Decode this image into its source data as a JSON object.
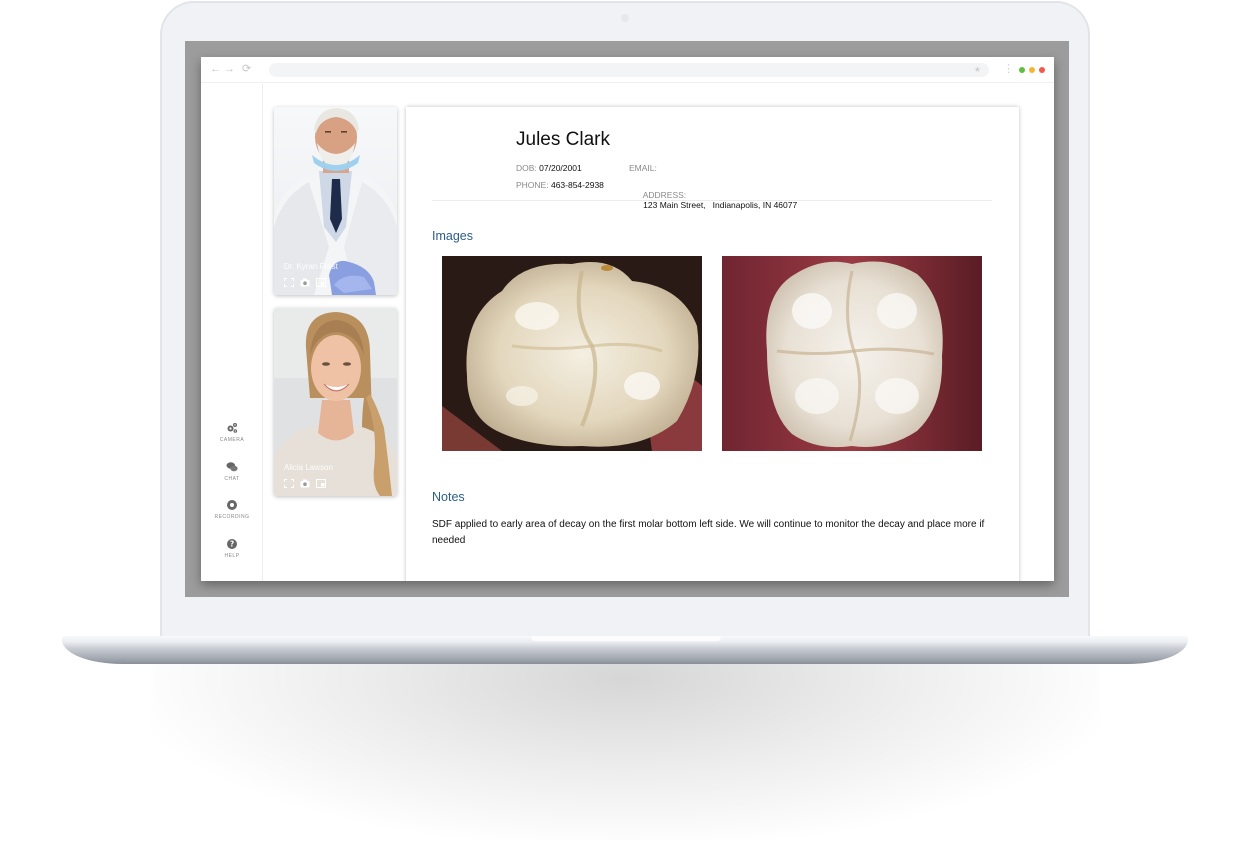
{
  "browser": {
    "nav": {
      "back_icon": "←",
      "forward_icon": "→",
      "reload_icon": "⟳"
    },
    "address_bar": {
      "value": "",
      "bookmark_icon": "★"
    },
    "menu_icon": "⋮",
    "window_dots": [
      "#5cbf3f",
      "#f4b731",
      "#f05a4f"
    ]
  },
  "rail": {
    "items": [
      {
        "id": "camera",
        "label": "CAMERA",
        "icon": "gears-icon"
      },
      {
        "id": "chat",
        "label": "CHAT",
        "icon": "chat-bubbles-icon"
      },
      {
        "id": "recording",
        "label": "RECORDING",
        "icon": "record-icon"
      },
      {
        "id": "help",
        "label": "HELP",
        "icon": "help-icon"
      }
    ]
  },
  "participants": [
    {
      "name": "Dr. Kyran Frost",
      "controls": [
        "fullscreen-icon",
        "camera-icon",
        "picture-in-picture-icon"
      ]
    },
    {
      "name": "Alicia Lawson",
      "controls": [
        "fullscreen-icon",
        "camera-icon",
        "picture-in-picture-icon"
      ]
    }
  ],
  "patient": {
    "name": "Jules Clark",
    "dob_label": "DOB:",
    "dob": "07/20/2001",
    "email_label": "EMAIL:",
    "email": "",
    "phone_label": "PHONE:",
    "phone": "463-854-2938",
    "address_label": "ADDRESS:",
    "address": "123 Main Street,   Indianapolis, IN 46077"
  },
  "images_section": {
    "title": "Images",
    "images": [
      {
        "alt": "Intraoral photo of molar occlusal surface 1"
      },
      {
        "alt": "Intraoral photo of molar occlusal surface 2"
      }
    ]
  },
  "notes_section": {
    "title": "Notes",
    "text": "SDF applied to early area of decay on the first molar bottom left side. We will continue to monitor the decay and place more if needed"
  },
  "colors": {
    "accent": "#2c5f86",
    "bezel": "#9c9c9c",
    "lid": "#f1f2f6"
  }
}
